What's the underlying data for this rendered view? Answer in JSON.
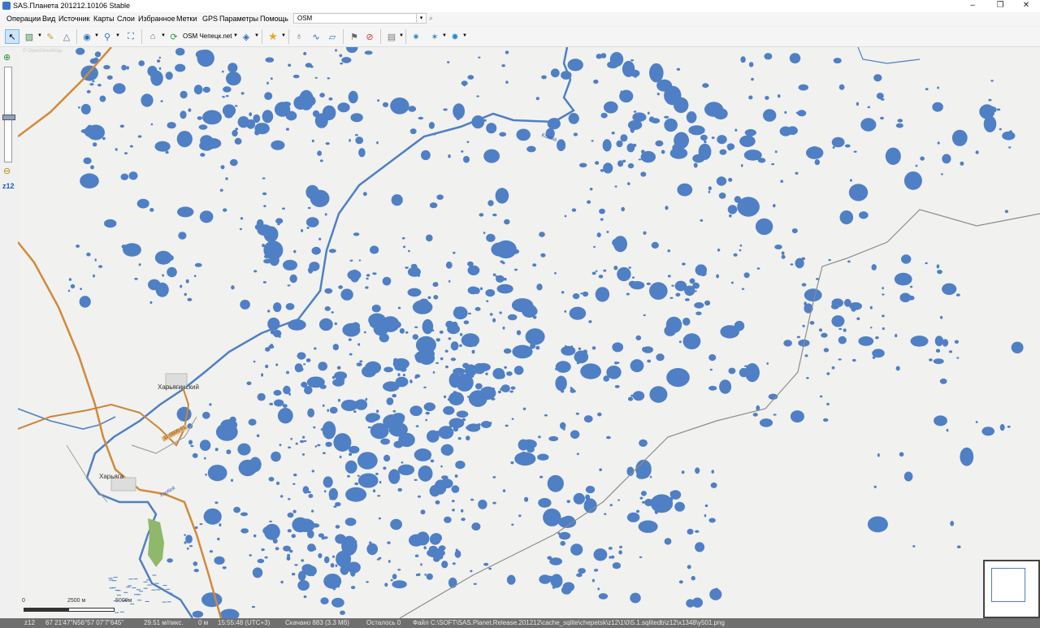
{
  "window": {
    "title": "SAS.Планета 201212.10106 Stable",
    "controls": [
      "–",
      "❐",
      "✕"
    ]
  },
  "menu": {
    "items": [
      "Операции",
      "Вид",
      "Источник",
      "Карты",
      "Слои",
      "Избранное",
      "Метки",
      "GPS",
      "Параметры",
      "Помощь"
    ],
    "map_selector": "OSM"
  },
  "toolbar": {
    "source_label": "OSM Чепецк.net"
  },
  "zoom": {
    "level_label": "z12"
  },
  "map": {
    "attribution": "© OpenStreetMap",
    "labels": {
      "town1": "Харьягинский",
      "town2": "Харьяга",
      "river1": "Колва",
      "river2": "Харбей",
      "road_ref": "11-0000-01"
    },
    "scale": {
      "label_0": "0",
      "label_1": "2500 м",
      "label_2": "5000м"
    }
  },
  "status": {
    "zoom": "z12",
    "coords": "67 21'47\"N56°57 07'7\"645\"",
    "resolution": "29.51 м/пикс.",
    "distance": "0 м",
    "time": "15:55:48 (UTC+3)",
    "downloaded": "Скачано 883 (3.3 Мб)",
    "remaining": "Осталось 0",
    "file": "Файл C:\\SOFT\\SAS.Planet.Release.201212\\cache_sqlite\\chepetsk\\z12\\1\\0\\5.1.sqlitedb\\z12\\x1348\\y501.png"
  },
  "colors": {
    "water": "#4f7fc5",
    "main_road": "#d08a3c",
    "boundary": "#8c8c8c",
    "map_bg": "#f1f1ef"
  }
}
